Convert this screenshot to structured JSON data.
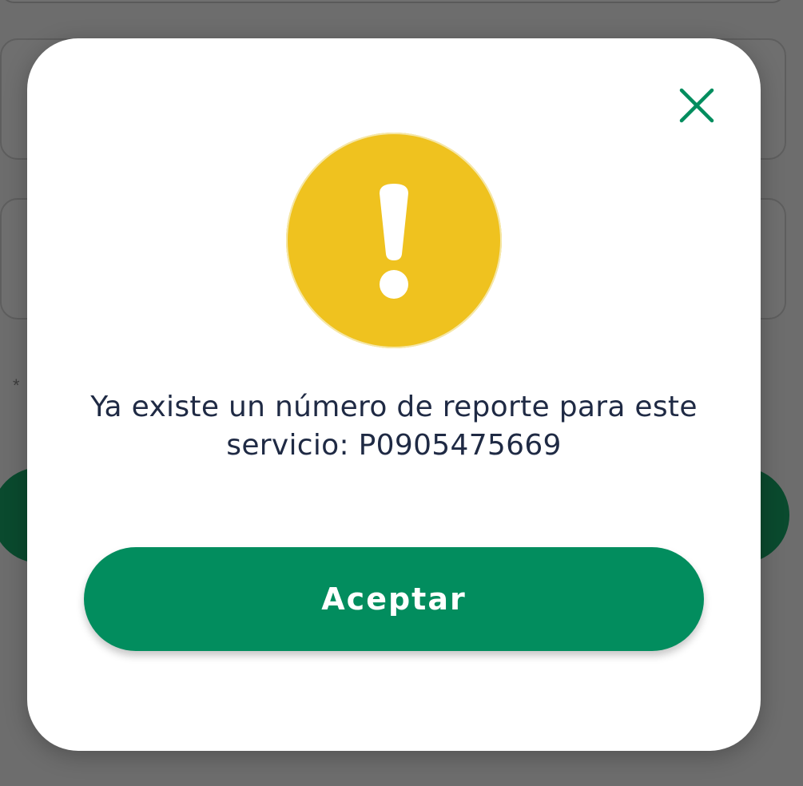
{
  "dialog": {
    "message_line1": "Ya existe un número de reporte para este",
    "message_line2": "servicio: P0905475669",
    "accept_label": "Aceptar"
  },
  "background": {
    "asterisk": "*"
  },
  "icons": {
    "close": "close-icon",
    "warning": "exclamation-icon"
  },
  "colors": {
    "accent_green": "#028d5e",
    "warning_yellow": "#efc21f",
    "text_dark": "#1f2a44"
  }
}
